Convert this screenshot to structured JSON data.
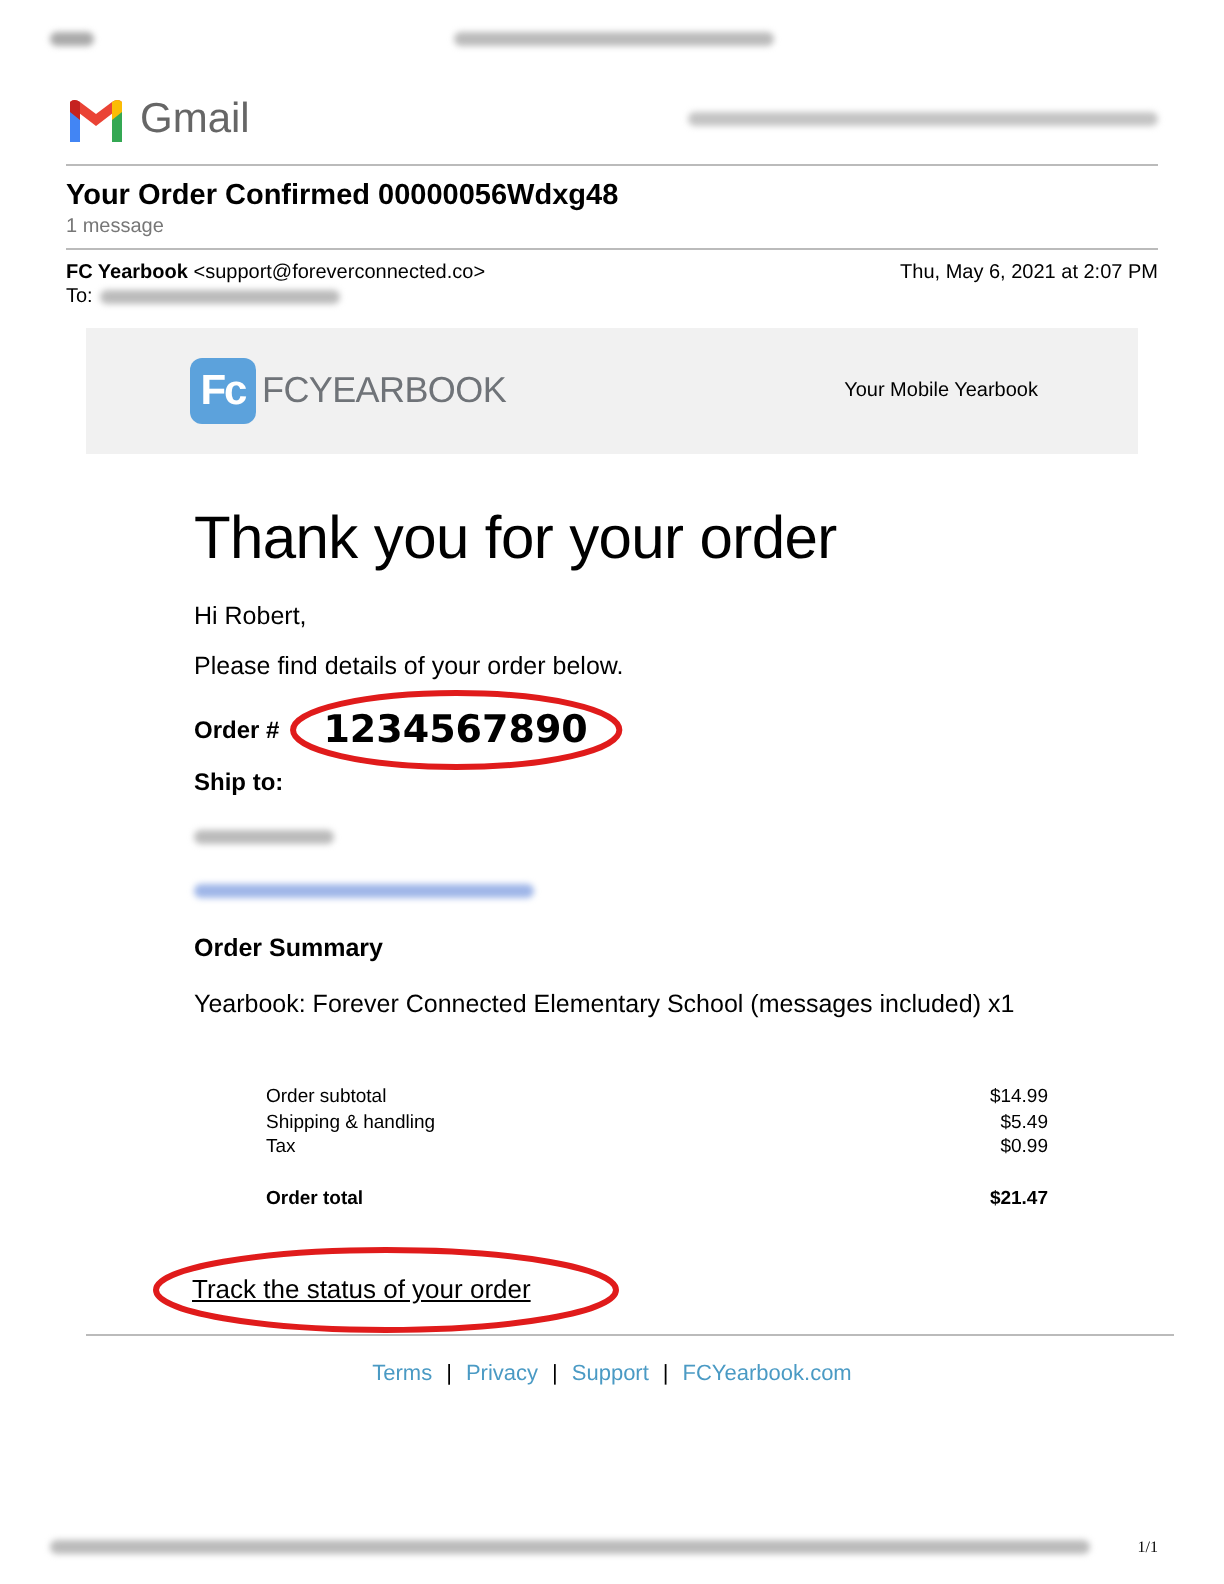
{
  "gmail": {
    "brand": "Gmail"
  },
  "subject": "Your Order Confirmed 00000056Wdxg48",
  "message_count": "1 message",
  "sender": {
    "name": "FC Yearbook",
    "email": "<support@foreverconnected.co>",
    "date": "Thu, May 6, 2021 at 2:07 PM",
    "to_label": "To:"
  },
  "banner": {
    "logo_mark": "Fc",
    "logo_text": "FCYEARBOOK",
    "tagline": "Your Mobile Yearbook"
  },
  "heading": "Thank you for your order",
  "greeting": "Hi Robert,",
  "intro": "Please find details of your order below.",
  "order": {
    "label": "Order #",
    "number": "1234567890"
  },
  "ship_to": "Ship to:",
  "summary": {
    "title": "Order Summary",
    "item": "Yearbook: Forever Connected Elementary School (messages included) x1"
  },
  "totals": [
    {
      "label": "Order subtotal",
      "amount": "$14.99",
      "bold": false
    },
    {
      "label": "Shipping & handling",
      "amount": "$5.49",
      "bold": false
    },
    {
      "label": "Tax",
      "amount": "$0.99",
      "bold": false
    },
    {
      "label": "Order total",
      "amount": "$21.47",
      "bold": true
    }
  ],
  "track_link": "Track the status of your order",
  "footer_links": [
    "Terms",
    "Privacy",
    "Support",
    "FCYearbook.com"
  ],
  "footer_separators": [
    "|",
    "|",
    "|"
  ],
  "page_number": "1/1"
}
